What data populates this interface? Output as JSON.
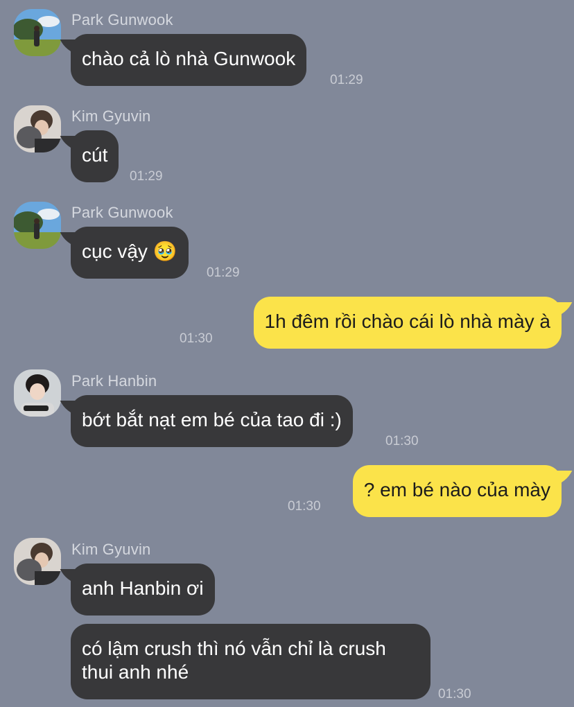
{
  "messages": [
    {
      "sender": "Park Gunwook",
      "text": "chào cả lò nhà Gunwook",
      "time": "01:29"
    },
    {
      "sender": "Kim Gyuvin",
      "text": "cút",
      "time": "01:29"
    },
    {
      "sender": "Park Gunwook",
      "text": "cục vậy 🥹",
      "time": "01:29"
    },
    {
      "sender": "me",
      "text": "1h đêm rồi chào cái lò nhà mày à",
      "time": "01:30"
    },
    {
      "sender": "Park Hanbin",
      "text": "bớt bắt nạt em bé của tao đi :)",
      "time": "01:30"
    },
    {
      "sender": "me",
      "text": "? em bé nào của mày",
      "time": "01:30"
    },
    {
      "sender": "Kim Gyuvin",
      "text": "anh Hanbin ơi",
      "time": ""
    },
    {
      "sender": "Kim Gyuvin",
      "text": "có lậm crush thì nó vẫn chỉ là crush thui anh nhé",
      "time": "01:30"
    }
  ],
  "colors": {
    "background": "#818899",
    "incoming_bubble": "#38383a",
    "outgoing_bubble": "#fbe34a"
  }
}
